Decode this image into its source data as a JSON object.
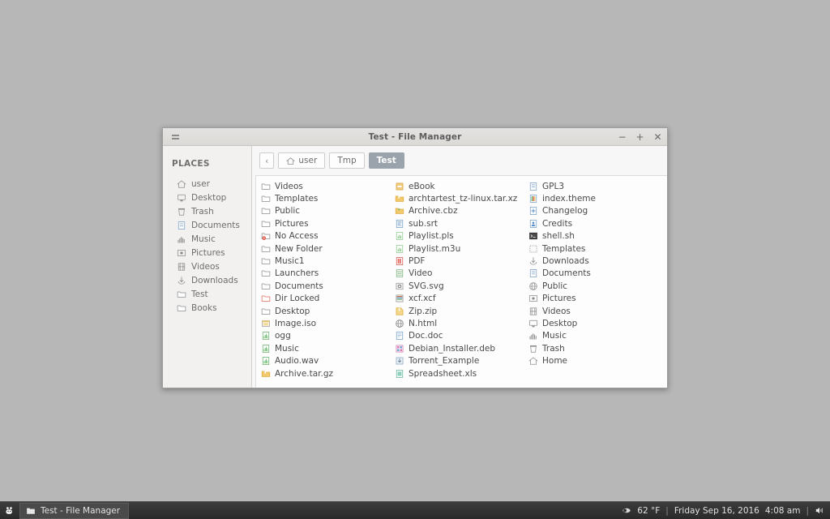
{
  "desktop": {
    "background_color": "#b7b7b7"
  },
  "window": {
    "title": "Test - File Manager",
    "menu_icon": "hamburger-menu-icon",
    "controls": {
      "minimize": "−",
      "maximize": "+",
      "close": "✕"
    }
  },
  "sidebar": {
    "heading": "PLACES",
    "items": [
      {
        "label": "user",
        "icon": "home-icon"
      },
      {
        "label": "Desktop",
        "icon": "desktop-icon"
      },
      {
        "label": "Trash",
        "icon": "trash-icon"
      },
      {
        "label": "Documents",
        "icon": "documents-icon"
      },
      {
        "label": "Music",
        "icon": "music-icon"
      },
      {
        "label": "Pictures",
        "icon": "pictures-icon"
      },
      {
        "label": "Videos",
        "icon": "videos-icon"
      },
      {
        "label": "Downloads",
        "icon": "downloads-icon"
      },
      {
        "label": "Test",
        "icon": "folder-icon"
      },
      {
        "label": "Books",
        "icon": "folder-icon"
      }
    ]
  },
  "pathbar": {
    "back_label": "‹",
    "crumbs": [
      {
        "label": "user",
        "icon": "home-icon",
        "active": false
      },
      {
        "label": "Tmp",
        "icon": "",
        "active": false
      },
      {
        "label": "Test",
        "icon": "",
        "active": true
      }
    ]
  },
  "filelist": {
    "columns": [
      [
        {
          "label": "Videos",
          "icon": "folder-icon"
        },
        {
          "label": "Templates",
          "icon": "folder-icon"
        },
        {
          "label": "Public",
          "icon": "folder-icon"
        },
        {
          "label": "Pictures",
          "icon": "folder-icon"
        },
        {
          "label": "No Access",
          "icon": "folder-noaccess-icon"
        },
        {
          "label": "New Folder",
          "icon": "folder-icon"
        },
        {
          "label": "Music1",
          "icon": "folder-icon"
        },
        {
          "label": "Launchers",
          "icon": "folder-icon"
        },
        {
          "label": "Documents",
          "icon": "folder-icon"
        },
        {
          "label": "Dir Locked",
          "icon": "folder-locked-icon"
        },
        {
          "label": "Desktop",
          "icon": "folder-icon"
        },
        {
          "label": "Image.iso",
          "icon": "iso-image-icon"
        },
        {
          "label": "ogg",
          "icon": "audio-icon"
        },
        {
          "label": "Music",
          "icon": "audio-icon"
        },
        {
          "label": "Audio.wav",
          "icon": "audio-icon"
        },
        {
          "label": "Archive.tar.gz",
          "icon": "archive-icon"
        }
      ],
      [
        {
          "label": "eBook",
          "icon": "ebook-icon"
        },
        {
          "label": "archtartest_tz-linux.tar.xz",
          "icon": "archive-icon"
        },
        {
          "label": "Archive.cbz",
          "icon": "archive-cbz-icon"
        },
        {
          "label": "sub.srt",
          "icon": "subtitle-icon"
        },
        {
          "label": "Playlist.pls",
          "icon": "playlist-icon"
        },
        {
          "label": "Playlist.m3u",
          "icon": "playlist-icon"
        },
        {
          "label": "PDF",
          "icon": "pdf-icon"
        },
        {
          "label": "Video",
          "icon": "video-file-icon"
        },
        {
          "label": "SVG.svg",
          "icon": "svg-icon"
        },
        {
          "label": "xcf.xcf",
          "icon": "xcf-icon"
        },
        {
          "label": "Zip.zip",
          "icon": "zip-icon"
        },
        {
          "label": "N.html",
          "icon": "html-icon"
        },
        {
          "label": "Doc.doc",
          "icon": "doc-icon"
        },
        {
          "label": "Debian_Installer.deb",
          "icon": "deb-package-icon"
        },
        {
          "label": "Torrent_Example",
          "icon": "torrent-icon"
        },
        {
          "label": "Spreadsheet.xls",
          "icon": "spreadsheet-icon"
        }
      ],
      [
        {
          "label": "GPL3",
          "icon": "text-document-icon"
        },
        {
          "label": "index.theme",
          "icon": "theme-file-icon"
        },
        {
          "label": "Changelog",
          "icon": "changelog-icon"
        },
        {
          "label": "Credits",
          "icon": "credits-icon"
        },
        {
          "label": "shell.sh",
          "icon": "terminal-script-icon"
        },
        {
          "label": "Templates",
          "icon": "templates-icon"
        },
        {
          "label": "Downloads",
          "icon": "downloads-icon"
        },
        {
          "label": "Documents",
          "icon": "documents-icon"
        },
        {
          "label": "Public",
          "icon": "public-icon"
        },
        {
          "label": "Pictures",
          "icon": "pictures-icon"
        },
        {
          "label": "Videos",
          "icon": "videos-icon"
        },
        {
          "label": "Desktop",
          "icon": "desktop-icon"
        },
        {
          "label": "Music",
          "icon": "music-icon"
        },
        {
          "label": "Trash",
          "icon": "trash-icon"
        },
        {
          "label": "Home",
          "icon": "home-icon"
        }
      ]
    ]
  },
  "taskbar": {
    "start_icon": "start-menu-icon",
    "task": {
      "label": "Test - File Manager",
      "icon": "folder-icon"
    },
    "tray": {
      "weather_icon": "weather-icon",
      "temperature": "62 °F",
      "separator": "|",
      "date": "Friday Sep 16, 2016",
      "time": "4:08 am",
      "volume_icon": "volume-icon"
    }
  },
  "colors": {
    "window_bg": "#f7f7f7",
    "sidebar_bg": "#f2f1f0",
    "accent_active": "#9aa3ab",
    "taskbar_bg": "#2f2f2f",
    "folder_outline": "#8d8d8d",
    "archive_yellow": "#f0c060",
    "audio_green": "#6fbf73",
    "red_badge": "#d94b3c"
  }
}
